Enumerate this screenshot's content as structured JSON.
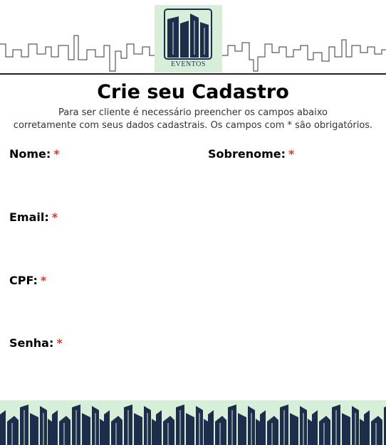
{
  "header": {
    "logo_text": "EVENTOS"
  },
  "form": {
    "title": "Crie seu Cadastro",
    "subtitle_line1": "Para ser cliente é necessário preencher os campos abaixo",
    "subtitle_line2": "corretamente com seus dados cadastrais. Os campos com * são obrigatórios.",
    "required_mark": "*",
    "fields": [
      {
        "label": "Nome:"
      },
      {
        "label": "Sobrenome:"
      },
      {
        "label": "Email:"
      },
      {
        "label": "CPF:"
      },
      {
        "label": "Senha:"
      }
    ]
  },
  "colors": {
    "brand_navy": "#1f2d4d",
    "brand_mint": "#d7efd9",
    "required_red": "#e0332d"
  }
}
